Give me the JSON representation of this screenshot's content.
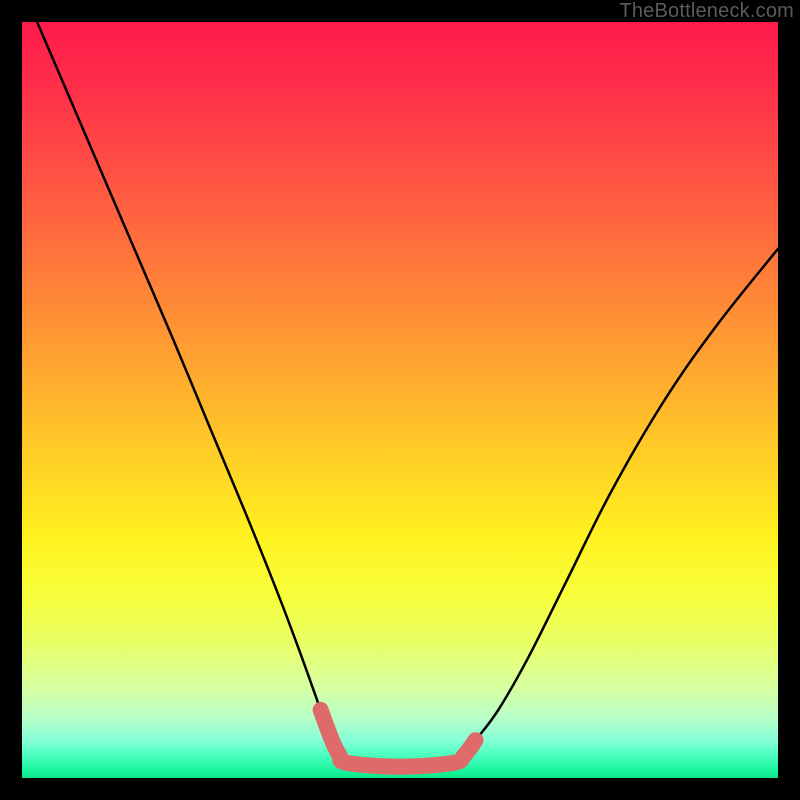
{
  "watermark": "TheBottleneck.com",
  "chart_data": {
    "type": "line",
    "title": "",
    "xlabel": "",
    "ylabel": "",
    "xlim": [
      0,
      100
    ],
    "ylim": [
      0,
      100
    ],
    "grid": false,
    "series": [
      {
        "name": "black-curve",
        "color": "#000000",
        "x": [
          2,
          8,
          14,
          20,
          25,
          30,
          34,
          37,
          39.5,
          41,
          42,
          43,
          50,
          57,
          58.5,
          60,
          63,
          67,
          72,
          78,
          85,
          92,
          100
        ],
        "y": [
          100,
          86,
          72,
          58,
          46,
          34,
          24,
          16,
          9,
          5,
          3,
          2,
          1.5,
          2,
          3,
          5,
          9,
          16,
          26,
          38,
          50,
          60,
          70
        ]
      },
      {
        "name": "red-overlay",
        "color": "#de6a6a",
        "x": [
          39.5,
          41,
          42,
          43,
          50,
          57,
          58.5,
          60
        ],
        "y": [
          9,
          5,
          3,
          2,
          1.5,
          2,
          3,
          5
        ]
      }
    ],
    "background_gradient": {
      "top": "#ff1a4b",
      "mid": "#fff11f",
      "bottom": "#0be68a"
    }
  }
}
